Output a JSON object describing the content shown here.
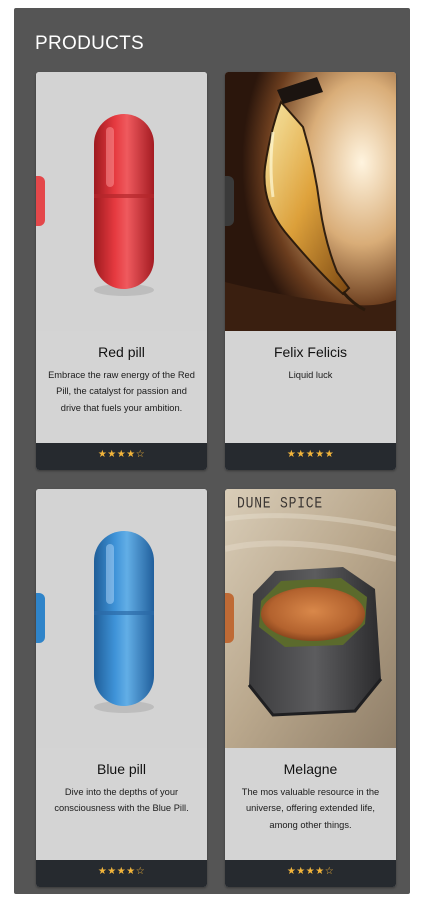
{
  "header": {
    "title": "PRODUCTS"
  },
  "products": [
    {
      "name": "Red pill",
      "description": "Embrace the raw energy of the Red Pill, the catalyst for passion and drive that fuels your ambition.",
      "rating": "★★★★☆",
      "accent": "#e4474a"
    },
    {
      "name": "Felix Felicis",
      "description": "Liquid luck",
      "rating": "★★★★★",
      "accent": "#3a3a3a"
    },
    {
      "name": "Blue pill",
      "description": "Dive into the depths of your consciousness with the Blue Pill.",
      "rating": "★★★★☆",
      "accent": "#2f84c9"
    },
    {
      "name": "Melagne",
      "description": "The mos valuable resource in the universe, offering extended life, among other things.",
      "rating": "★★★★☆",
      "accent": "#bf6a35",
      "image_caption": "DUNE SPICE"
    }
  ]
}
